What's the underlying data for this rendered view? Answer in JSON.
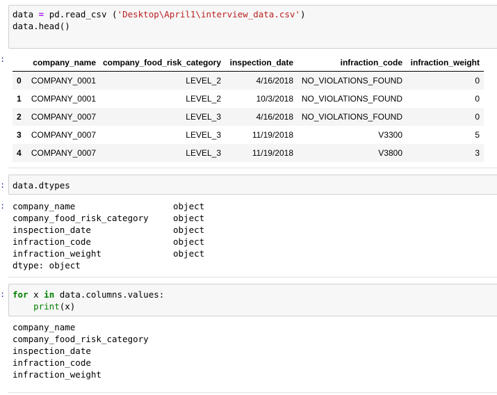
{
  "prompts": {
    "cell": ":"
  },
  "cell1": {
    "line1": {
      "var": "data",
      "op": "=",
      "call": "pd.read_csv (",
      "arg": "'Desktop\\April1\\interview_data.csv'",
      "close": ")"
    },
    "line2": "data.head()"
  },
  "dataframe": {
    "columns": [
      "company_name",
      "company_food_risk_category",
      "inspection_date",
      "infraction_code",
      "infraction_weight"
    ],
    "rows": [
      {
        "index": "0",
        "company_name": "COMPANY_0001",
        "risk": "LEVEL_2",
        "date": "4/16/2018",
        "code": "NO_VIOLATIONS_FOUND",
        "weight": "0"
      },
      {
        "index": "1",
        "company_name": "COMPANY_0001",
        "risk": "LEVEL_2",
        "date": "10/3/2018",
        "code": "NO_VIOLATIONS_FOUND",
        "weight": "0"
      },
      {
        "index": "2",
        "company_name": "COMPANY_0007",
        "risk": "LEVEL_3",
        "date": "4/16/2018",
        "code": "NO_VIOLATIONS_FOUND",
        "weight": "0"
      },
      {
        "index": "3",
        "company_name": "COMPANY_0007",
        "risk": "LEVEL_3",
        "date": "11/19/2018",
        "code": "V3300",
        "weight": "5"
      },
      {
        "index": "4",
        "company_name": "COMPANY_0007",
        "risk": "LEVEL_3",
        "date": "11/19/2018",
        "code": "V3800",
        "weight": "3"
      }
    ]
  },
  "cell2": {
    "code": "data.dtypes"
  },
  "dtypes_output": [
    {
      "name": "company_name",
      "type": "object"
    },
    {
      "name": "company_food_risk_category",
      "type": "object"
    },
    {
      "name": "inspection_date",
      "type": "object"
    },
    {
      "name": "infraction_code",
      "type": "object"
    },
    {
      "name": "infraction_weight",
      "type": "object"
    }
  ],
  "dtypes_footer": "dtype: object",
  "cell3": {
    "kw_for": "for",
    "var": "x",
    "kw_in": "in",
    "iter": "data.columns.values:",
    "indent": "    ",
    "print_fn": "print",
    "print_args": "(x)"
  },
  "print_output": [
    "company_name",
    "company_food_risk_category",
    "inspection_date",
    "infraction_code",
    "infraction_weight"
  ]
}
